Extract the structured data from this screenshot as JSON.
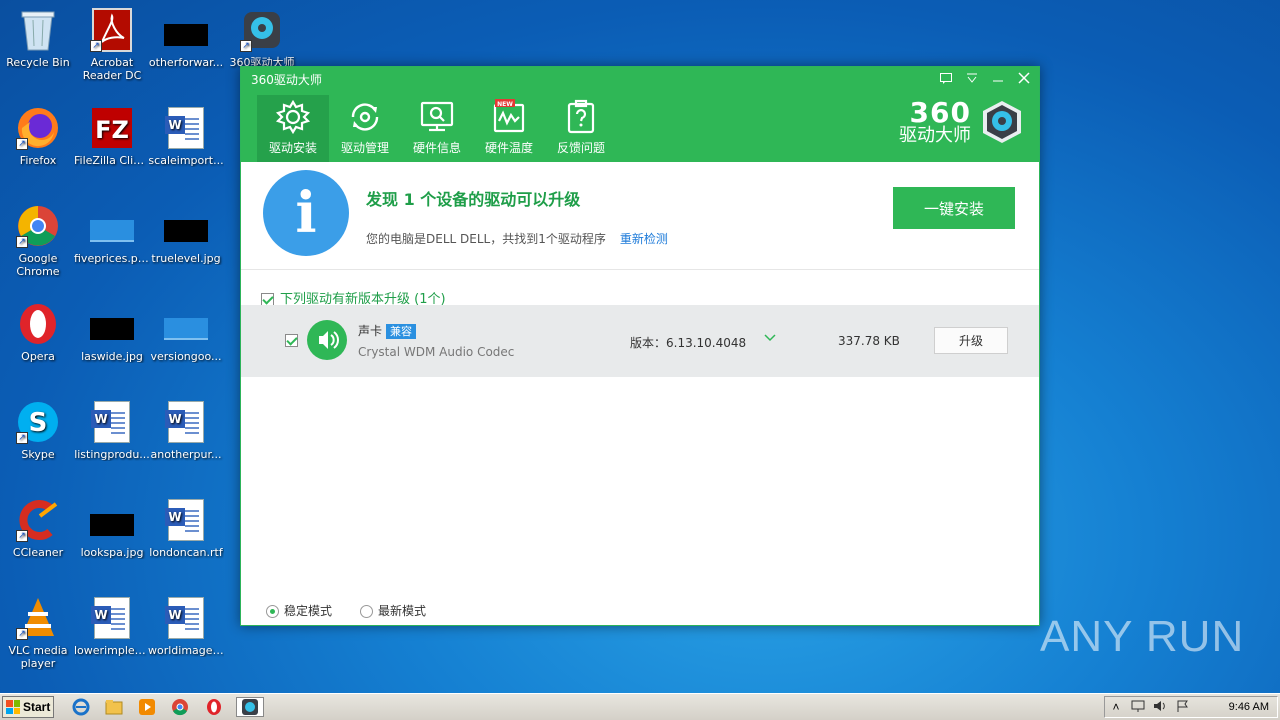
{
  "desktop": {
    "icons": [
      {
        "label": "Recycle Bin"
      },
      {
        "label": "Acrobat Reader DC"
      },
      {
        "label": "otherforwar..."
      },
      {
        "label": "360驱动大师"
      },
      {
        "label": "Firefox"
      },
      {
        "label": "FileZilla Client"
      },
      {
        "label": "scaleimport..."
      },
      {
        "label": "Google Chrome"
      },
      {
        "label": "fiveprices.png"
      },
      {
        "label": "truelevel.jpg"
      },
      {
        "label": "Opera"
      },
      {
        "label": "laswide.jpg"
      },
      {
        "label": "versiongoo..."
      },
      {
        "label": "Skype"
      },
      {
        "label": "listingprodu..."
      },
      {
        "label": "anotherpur..."
      },
      {
        "label": "CCleaner"
      },
      {
        "label": "lookspa.jpg"
      },
      {
        "label": "londoncan.rtf"
      },
      {
        "label": "VLC media player"
      },
      {
        "label": "lowerimplem..."
      },
      {
        "label": "worldimage.rtf"
      }
    ]
  },
  "app": {
    "title": "360驱动大师",
    "tabs": [
      {
        "label": "驱动安装",
        "icon": "gear-icon",
        "active": true
      },
      {
        "label": "驱动管理",
        "icon": "refresh-icon",
        "active": false
      },
      {
        "label": "硬件信息",
        "icon": "monitor-search-icon",
        "active": false
      },
      {
        "label": "硬件温度",
        "icon": "thermometer-icon",
        "badge": "NEW",
        "active": false
      },
      {
        "label": "反馈问题",
        "icon": "question-clipboard-icon",
        "active": false
      }
    ],
    "brand": {
      "number": "360",
      "name": "驱动大师"
    },
    "summary": {
      "title": "发现 1 个设备的驱动可以升级",
      "desc": "您的电脑是DELL DELL，共找到1个驱动程序",
      "rescan": "重新检测",
      "install_label": "一键安装"
    },
    "list_header": "下列驱动有新版本升级 (1个)",
    "driver": {
      "name": "声卡",
      "badge": "兼容",
      "sub": "Crystal WDM Audio Codec",
      "version": "版本：6.13.10.4048",
      "size": "337.78 KB",
      "upgrade_label": "升级"
    },
    "modes": [
      {
        "label": "稳定模式",
        "selected": true
      },
      {
        "label": "最新模式",
        "selected": false
      }
    ],
    "colors": {
      "green": "#2fb756",
      "blue": "#3b9ee8"
    }
  },
  "watermark": "ANY RUN",
  "taskbar": {
    "start_label": "Start",
    "clock": "9:46 AM"
  }
}
